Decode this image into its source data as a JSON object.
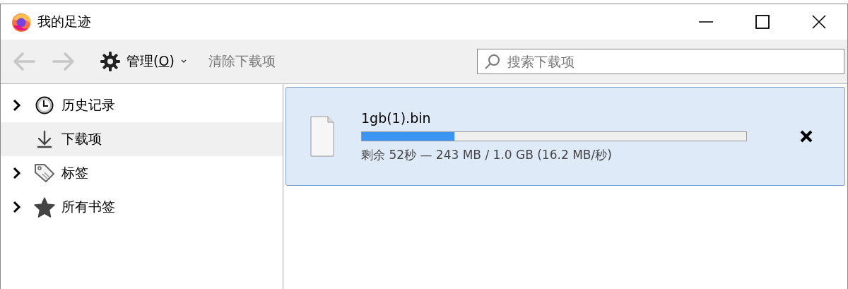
{
  "window": {
    "title": "我的足迹"
  },
  "toolbar": {
    "back_disabled": true,
    "forward_disabled": true,
    "organize": {
      "label_before": "管理(",
      "access_key": "O",
      "label_after": ")"
    },
    "clear_label": "清除下载项",
    "clear_disabled": true,
    "search": {
      "placeholder": "搜索下载项"
    }
  },
  "sidebar": {
    "items": [
      {
        "label": "历史记录",
        "kind": "folder",
        "expanded": false,
        "selected": false
      },
      {
        "label": "下载项",
        "kind": "leaf",
        "selected": true
      },
      {
        "label": "标签",
        "kind": "folder",
        "expanded": false,
        "selected": false
      },
      {
        "label": "所有书签",
        "kind": "folder",
        "expanded": false,
        "selected": false
      }
    ]
  },
  "downloads": [
    {
      "name": "1gb(1).bin",
      "level": 0.24,
      "status": "剩余 52秒 — 243 MB / 1.0 GB (16.2 MB/秒)",
      "selected": true
    }
  ]
}
